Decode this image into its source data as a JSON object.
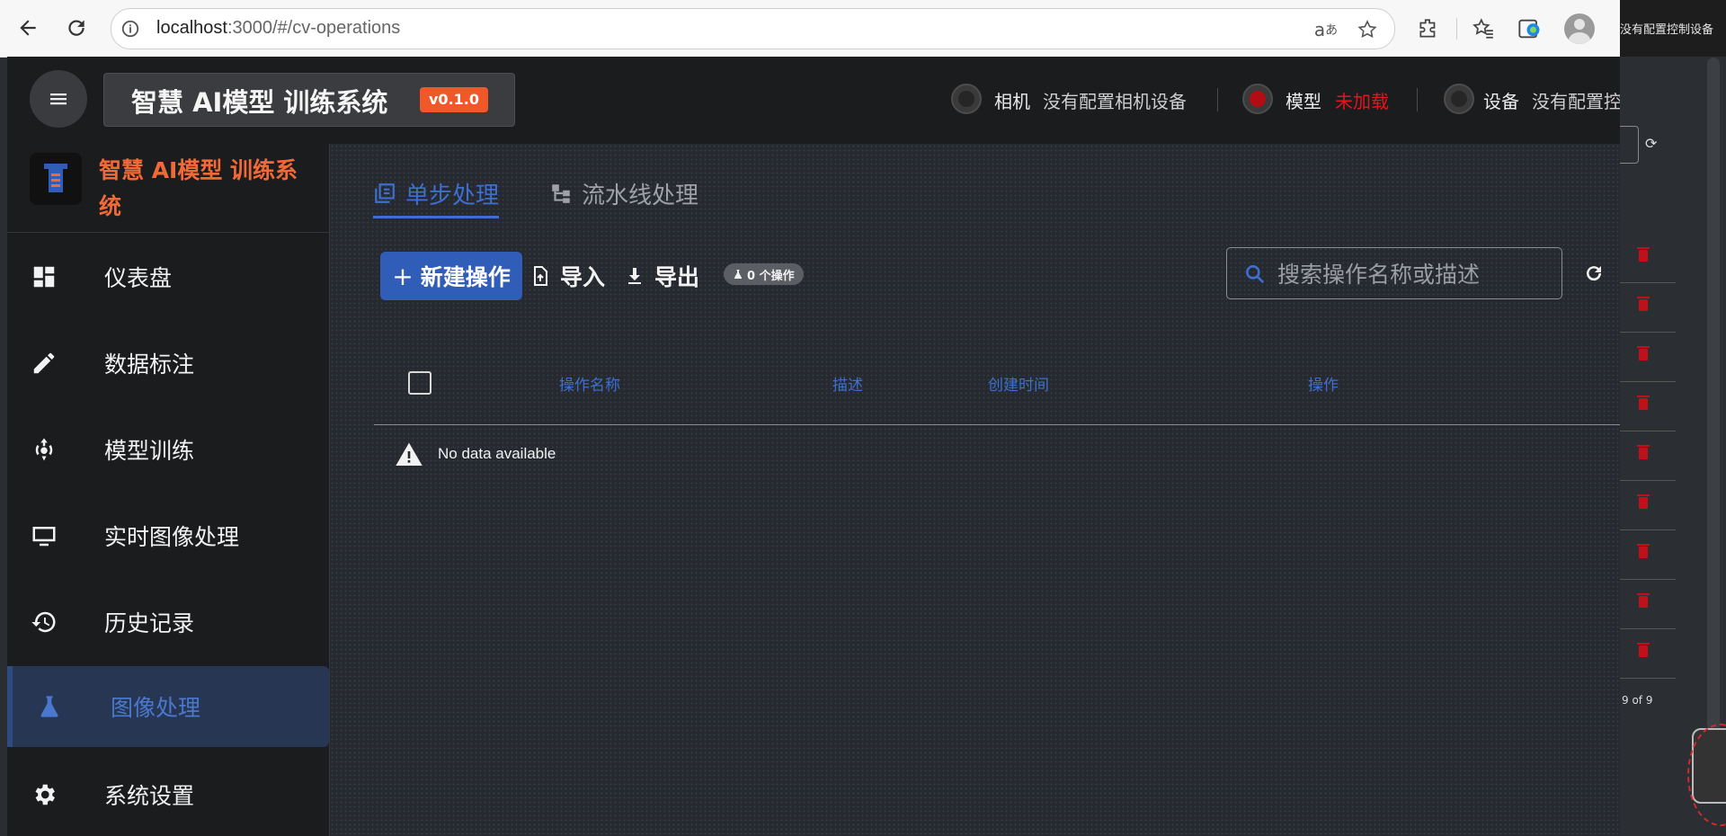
{
  "browser": {
    "url_host": "localhost",
    "url_path": ":3000/#/cv-operations"
  },
  "background_app": {
    "topbar_text": "没有配置控制设备",
    "pagination": "9 of 9",
    "row_count": 9
  },
  "header": {
    "app_title": "智慧 AI模型 训练系统",
    "version": "v0.1.0",
    "statuses": [
      {
        "label": "相机",
        "value": "没有配置相机设备",
        "state": "off"
      },
      {
        "label": "模型",
        "value": "未加载",
        "state": "error"
      },
      {
        "label": "设备",
        "value": "没有配置控",
        "state": "off"
      }
    ]
  },
  "sidebar": {
    "brand": "智慧 AI模型 训练系统",
    "items": [
      {
        "label": "仪表盘",
        "icon": "dashboard-icon",
        "active": false
      },
      {
        "label": "数据标注",
        "icon": "pencil-icon",
        "active": false
      },
      {
        "label": "模型训练",
        "icon": "training-icon",
        "active": false
      },
      {
        "label": "实时图像处理",
        "icon": "monitor-icon",
        "active": false
      },
      {
        "label": "历史记录",
        "icon": "history-icon",
        "active": false
      },
      {
        "label": "图像处理",
        "icon": "flask-icon",
        "active": true
      },
      {
        "label": "系统设置",
        "icon": "gear-icon",
        "active": false
      }
    ]
  },
  "main": {
    "tabs": [
      {
        "label": "单步处理",
        "active": true
      },
      {
        "label": "流水线处理",
        "active": false
      }
    ],
    "toolbar": {
      "new_label": "新建操作",
      "import_label": "导入",
      "export_label": "导出",
      "count_badge": "0 个操作"
    },
    "search": {
      "placeholder": "搜索操作名称或描述",
      "value": ""
    },
    "table": {
      "columns": [
        "操作名称",
        "描述",
        "创建时间",
        "操作"
      ],
      "rows": [],
      "empty_text": "No data available"
    }
  },
  "colors": {
    "accent": "#3d6fd0",
    "brand_orange": "#f06a37",
    "error_red": "#e2161d"
  }
}
